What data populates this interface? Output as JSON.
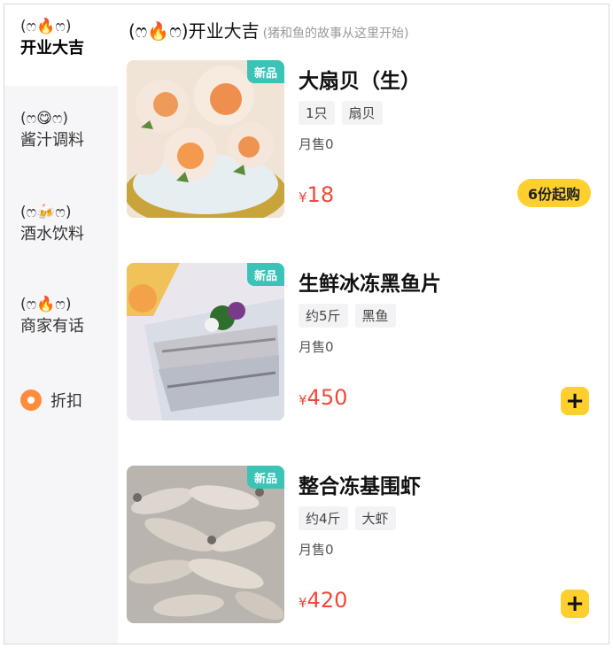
{
  "sidebar": {
    "items": [
      {
        "emoji": "(ෆ🔥ෆ)",
        "label": "开业大吉",
        "active": true
      },
      {
        "emoji": "(ෆ😋ෆ)",
        "label": "酱汁调料"
      },
      {
        "emoji": "(ෆ🍻ෆ)",
        "label": "酒水饮料"
      },
      {
        "emoji": "(ෆ🔥ෆ)",
        "label": "商家有话"
      }
    ],
    "discount_label": "折扣",
    "discount_icon": "location-pin-icon"
  },
  "section": {
    "title": "(ෆ🔥ෆ)开业大吉",
    "subtitle": "(猪和鱼的故事从这里开始)"
  },
  "products": [
    {
      "badge": "新品",
      "name": "大扇贝（生）",
      "tags": [
        "1只",
        "扇贝"
      ],
      "sold": "月售0",
      "currency": "¥",
      "price": "18",
      "min_label": "6份起购"
    },
    {
      "badge": "新品",
      "name": "生鲜冰冻黑鱼片",
      "tags": [
        "约5斤",
        "黑鱼"
      ],
      "sold": "月售0",
      "currency": "¥",
      "price": "450",
      "add_label": "+"
    },
    {
      "badge": "新品",
      "name": "整合冻基围虾",
      "tags": [
        "约4斤",
        "大虾"
      ],
      "sold": "月售0",
      "currency": "¥",
      "price": "420",
      "add_label": "+"
    }
  ],
  "colors": {
    "accent": "#ffcf2e",
    "price": "#ef4a3a",
    "badge": "#3bc3b8"
  }
}
